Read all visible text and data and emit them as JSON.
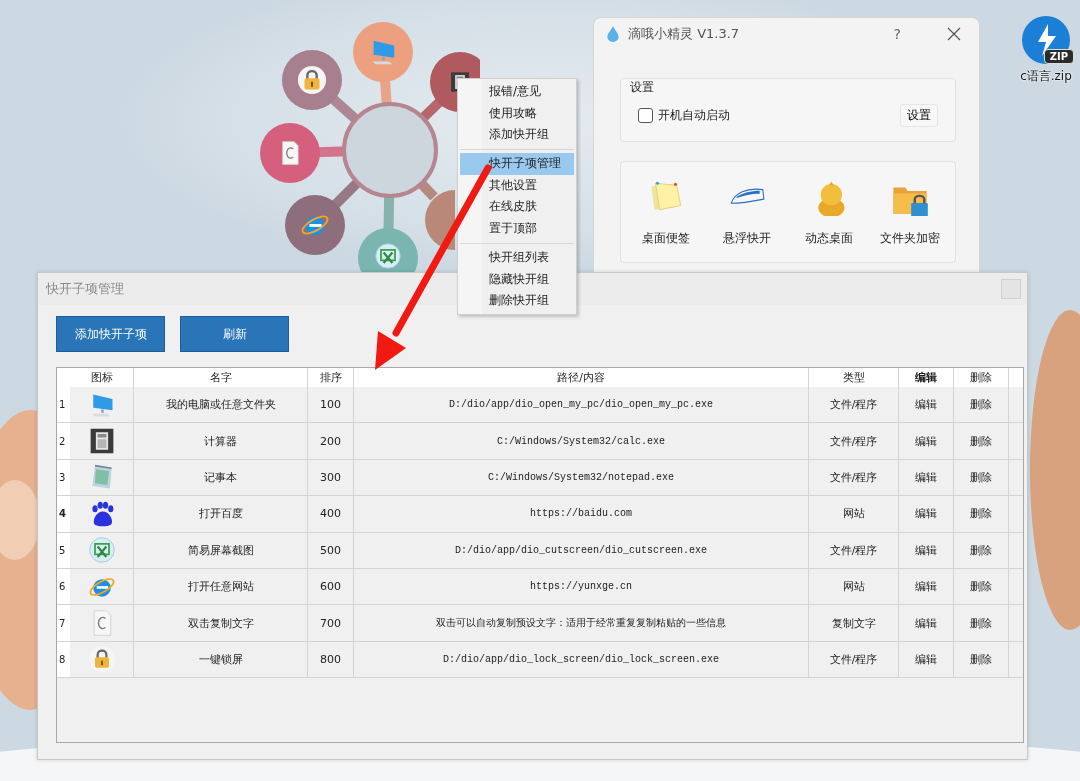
{
  "desktop": {
    "file_icon": {
      "badge": "ZIP",
      "label": "c语言.zip"
    }
  },
  "main_window": {
    "title": "滴哦小精灵 V1.3.7",
    "help": "?",
    "settings": {
      "legend": "设置",
      "autostart": {
        "label": "开机自动启动",
        "checked": false
      },
      "button": "设置"
    },
    "tools": [
      {
        "label": "桌面便签"
      },
      {
        "label": "悬浮快开"
      },
      {
        "label": "动态桌面"
      },
      {
        "label": "文件夹加密"
      }
    ]
  },
  "context_menu": {
    "groups": [
      {
        "items": [
          {
            "label": "报错/意见",
            "selected": false
          },
          {
            "label": "使用攻略",
            "selected": false
          },
          {
            "label": "添加快开组",
            "selected": false
          }
        ]
      },
      {
        "items": [
          {
            "label": "快开子项管理",
            "selected": true
          },
          {
            "label": "其他设置",
            "selected": false
          },
          {
            "label": "在线皮肤",
            "selected": false
          },
          {
            "label": "置于顶部",
            "selected": false
          }
        ]
      },
      {
        "items": [
          {
            "label": "快开组列表",
            "selected": false
          },
          {
            "label": "隐藏快开组",
            "selected": false
          },
          {
            "label": "删除快开组",
            "selected": false
          }
        ]
      }
    ]
  },
  "manager": {
    "title": "快开子项管理",
    "buttons": [
      "添加快开子项",
      "刷新"
    ],
    "table": {
      "columns": [
        {
          "label": "图标",
          "current": false
        },
        {
          "label": "名字",
          "current": false
        },
        {
          "label": "排序",
          "current": false
        },
        {
          "label": "路径/内容",
          "current": false
        },
        {
          "label": "类型",
          "current": false
        },
        {
          "label": "编辑",
          "current": true
        },
        {
          "label": "删除",
          "current": false
        }
      ],
      "rows": [
        {
          "number": "1",
          "current": false,
          "name": "我的电脑或任意文件夹",
          "order": "100",
          "path": "D:/dio/app/dio_open_my_pc/dio_open_my_pc.exe",
          "type": "文件/程序",
          "edit": "编辑",
          "delete": "删除"
        },
        {
          "number": "2",
          "current": false,
          "name": "计算器",
          "order": "200",
          "path": "C:/Windows/System32/calc.exe",
          "type": "文件/程序",
          "edit": "编辑",
          "delete": "删除"
        },
        {
          "number": "3",
          "current": false,
          "name": "记事本",
          "order": "300",
          "path": "C:/Windows/System32/notepad.exe",
          "type": "文件/程序",
          "edit": "编辑",
          "delete": "删除"
        },
        {
          "number": "4",
          "current": true,
          "name": "打开百度",
          "order": "400",
          "path": "https://baidu.com",
          "type": "网站",
          "edit": "编辑",
          "delete": "删除"
        },
        {
          "number": "5",
          "current": false,
          "name": "简易屏幕截图",
          "order": "500",
          "path": "D:/dio/app/dio_cutscreen/dio_cutscreen.exe",
          "type": "文件/程序",
          "edit": "编辑",
          "delete": "删除"
        },
        {
          "number": "6",
          "current": false,
          "name": "打开任意网站",
          "order": "600",
          "path": "https://yunxge.cn",
          "type": "网站",
          "edit": "编辑",
          "delete": "删除"
        },
        {
          "number": "7",
          "current": false,
          "name": "双击复制文字",
          "order": "700",
          "path": "双击可以自动复制预设文字：适用于经常重复复制粘贴的一些信息",
          "type": "复制文字",
          "edit": "编辑",
          "delete": "删除"
        },
        {
          "number": "8",
          "current": false,
          "name": "一键锁屏",
          "order": "800",
          "path": "D:/dio/app/dio_lock_screen/dio_lock_screen.exe",
          "type": "文件/程序",
          "edit": "编辑",
          "delete": "删除"
        }
      ]
    }
  }
}
